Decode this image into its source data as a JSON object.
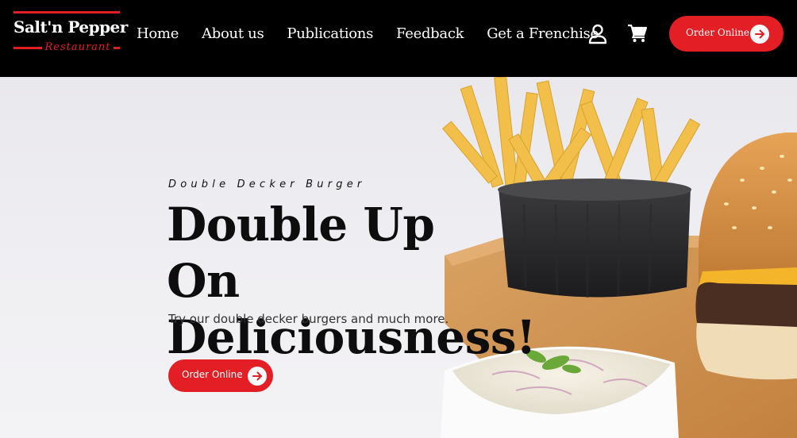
{
  "brand": {
    "logo_main": "Salt'n Pepper",
    "logo_sub": "Restaurant"
  },
  "nav": {
    "items": [
      {
        "label": "Home"
      },
      {
        "label": "About us"
      },
      {
        "label": "Publications"
      },
      {
        "label": "Feedback"
      },
      {
        "label": "Get a Frenchise"
      }
    ]
  },
  "header": {
    "account_icon": "user-icon",
    "cart_icon": "cart-icon",
    "order_label": "Order Online"
  },
  "hero": {
    "eyebrow": "Double Decker Burger",
    "headline": "Double Up On Deliciousness!",
    "subtext": "Try our double decker burgers and much more.",
    "order_label": "Order Online"
  },
  "colors": {
    "accent": "#e31e24",
    "header_bg": "#000000",
    "hero_bg": "#eeedf1",
    "text_dark": "#0d0d0d"
  }
}
